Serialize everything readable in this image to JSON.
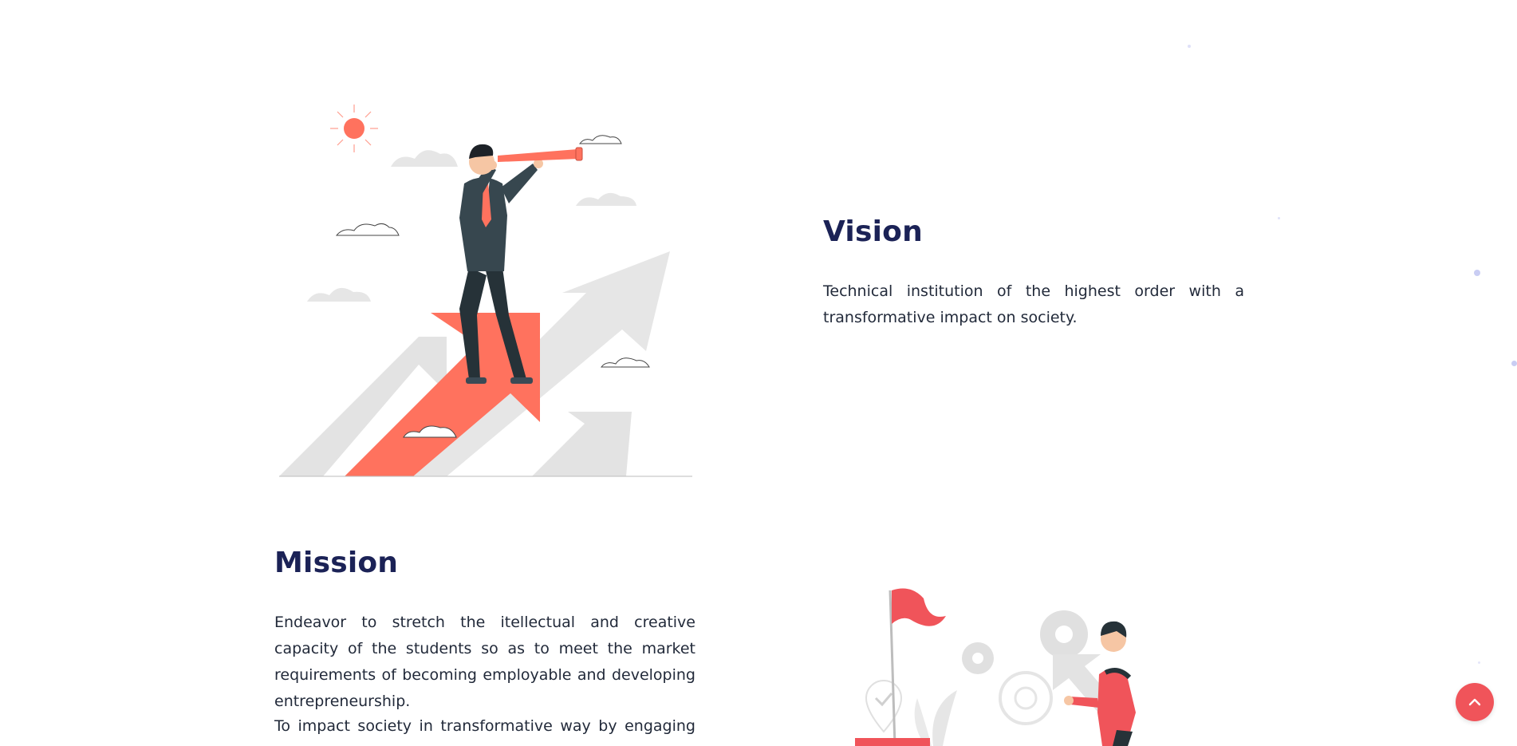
{
  "vision": {
    "heading": "Vision",
    "text": "Technical institution of the highest order with a transformative impact on society.",
    "illustration_icon": "man-with-telescope-on-arrow-illustration"
  },
  "mission": {
    "heading": "Mission",
    "paragraphs": [
      "Endeavor to stretch the itellectual and creative capacity of the students so as to meet the market requirements of becoming employable and developing entrepreneurship.",
      "To impact society in transformative way by engaging with"
    ],
    "illustration_icon": "man-pushing-arrow-to-flag-illustration"
  },
  "scroll_top_button": {
    "icon": "chevron-up-icon"
  },
  "colors": {
    "heading": "#1b2256",
    "body_text": "#222a3a",
    "accent": "#f0545a",
    "illustration_coral": "#ff725e",
    "illustration_grey": "#e0e0e0",
    "decor_dot": "#c9cdf3"
  }
}
